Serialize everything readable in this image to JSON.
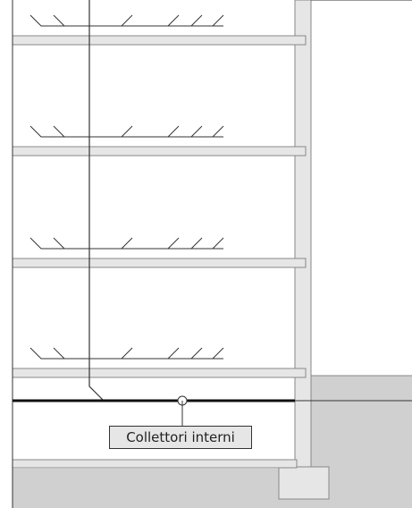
{
  "diagram": {
    "label": "Collettori interni",
    "colors": {
      "ground": "#d0d0d0",
      "slab": "#e6e6e6",
      "wall": "#e6e6e6",
      "outline": "#888888",
      "line": "#333333",
      "collector": "#111111"
    },
    "floors": [
      {
        "name": "floor-4",
        "has_branch_network": true
      },
      {
        "name": "floor-3",
        "has_branch_network": true
      },
      {
        "name": "floor-2",
        "has_branch_network": true
      },
      {
        "name": "floor-1",
        "has_branch_network": true
      },
      {
        "name": "basement",
        "has_branch_network": false
      }
    ]
  }
}
